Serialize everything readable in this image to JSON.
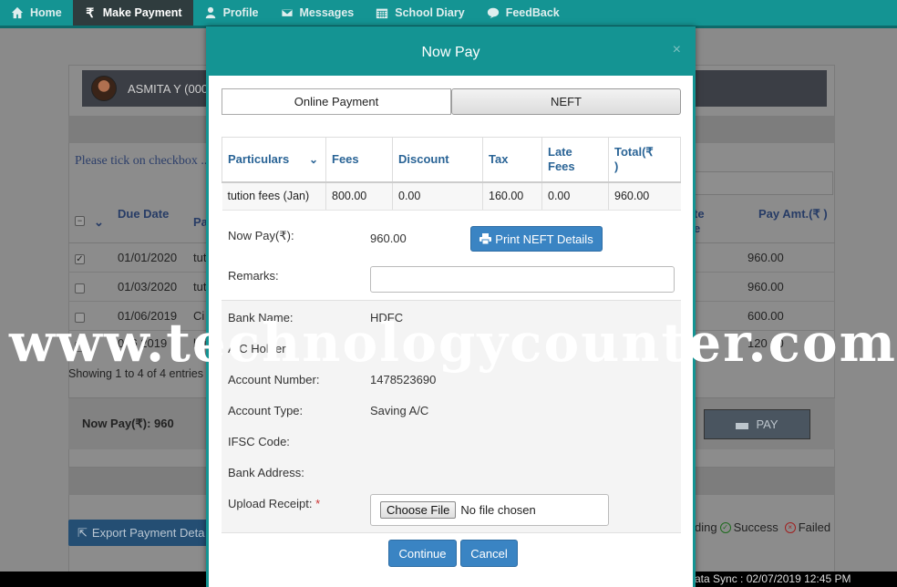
{
  "nav": {
    "items": [
      {
        "label": "Home",
        "icon": "home-icon"
      },
      {
        "label": "Make Payment",
        "icon": "rupee-icon",
        "active": true
      },
      {
        "label": "Profile",
        "icon": "user-icon"
      },
      {
        "label": "Messages",
        "icon": "envelope-icon"
      },
      {
        "label": "School Diary",
        "icon": "calendar-icon"
      },
      {
        "label": "FeedBack",
        "icon": "chat-icon"
      }
    ]
  },
  "background": {
    "student_name": "ASMITA Y (000",
    "hint": "Please tick on checkbox ...",
    "table": {
      "headers": [
        "Due Date",
        "Pa",
        "te e",
        "Pay Amt.(₹ )"
      ],
      "rows": [
        {
          "checked": true,
          "date": "01/01/2020",
          "particular": "tut",
          "amount": "960.00"
        },
        {
          "checked": false,
          "date": "01/03/2020",
          "particular": "tut",
          "amount": "960.00"
        },
        {
          "checked": false,
          "date": "01/06/2019",
          "particular": "Ci",
          "amount": "600.00"
        },
        {
          "checked": false,
          "date": "0 /6 2019",
          "particular": "bu",
          "amount": "120 00"
        }
      ]
    },
    "showing": "Showing 1 to 4 of 4 entries",
    "now_pay": "Now Pay(₹): 960",
    "pay_label": "PAY",
    "export_label": "Export Payment Deta",
    "legend": {
      "pending": "ding",
      "success": "Success",
      "failed": "Failed"
    },
    "data_sync": "ata Sync : 02/07/2019 12:45 PM"
  },
  "watermark": "www.technologycounter.com",
  "modal": {
    "title": "Now Pay",
    "close": "×",
    "tabs": {
      "online": "Online Payment",
      "neft": "NEFT"
    },
    "fee_table": {
      "headers": {
        "particulars": "Particulars",
        "fees": "Fees",
        "discount": "Discount",
        "tax": "Tax",
        "late_fees": "Late Fees",
        "total": "Total(₹ )"
      },
      "row": {
        "particulars": "tution fees (Jan)",
        "fees": "800.00",
        "discount": "0.00",
        "tax": "160.00",
        "late_fees": "0.00",
        "total": "960.00"
      }
    },
    "now_pay_label": "Now Pay(₹):",
    "now_pay_value": "960.00",
    "print_button": "Print NEFT Details",
    "remarks_label": "Remarks:",
    "bank": {
      "bank_name_label": "Bank Name:",
      "bank_name": "HDFC",
      "holder_label": "A/C Holder:",
      "holder": "",
      "account_number_label": "Account Number:",
      "account_number": "1478523690",
      "account_type_label": "Account Type:",
      "account_type": "Saving A/C",
      "ifsc_label": "IFSC Code:",
      "ifsc": "",
      "address_label": "Bank Address:",
      "address": ""
    },
    "upload_label": "Upload Receipt:",
    "upload_required": "*",
    "choose_file": "Choose File",
    "no_file": "No file chosen",
    "continue_button": "Continue",
    "cancel_button": "Cancel"
  }
}
